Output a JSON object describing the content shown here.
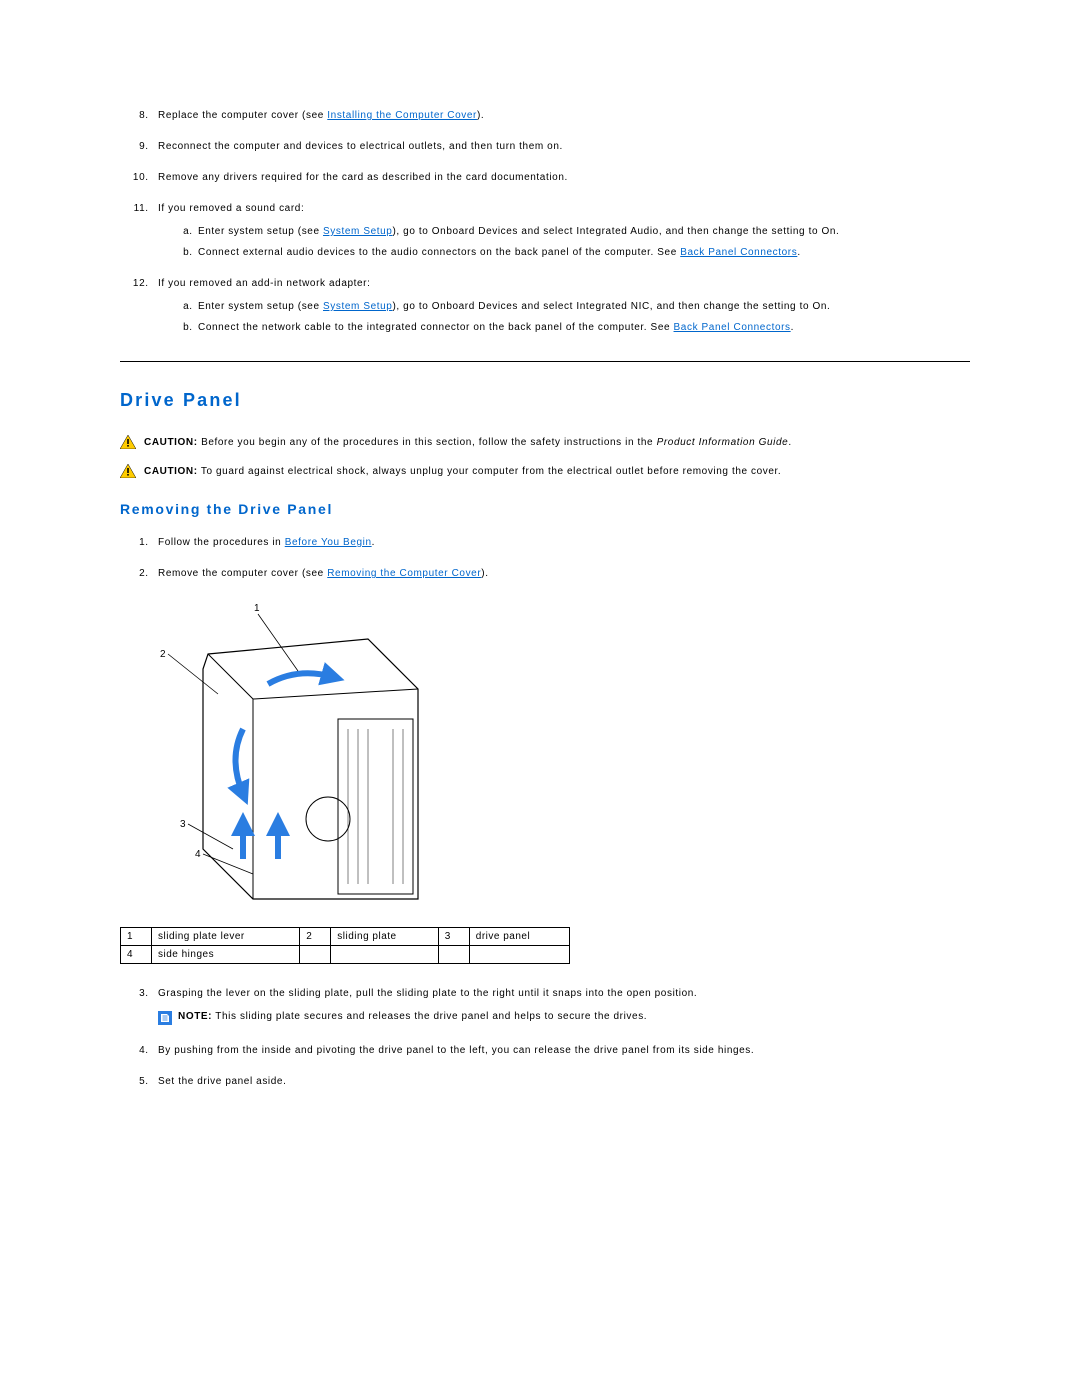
{
  "top_steps": {
    "start": 8,
    "items": [
      {
        "prefix": "Replace the computer cover (see ",
        "link": "Installing the Computer Cover",
        "suffix": ")."
      },
      {
        "text": "Reconnect the computer and devices to electrical outlets, and then turn them on."
      },
      {
        "text": "Remove any drivers required for the card as described in the card documentation."
      },
      {
        "text": "If you removed a sound card:",
        "sub": [
          {
            "prefix": "Enter system setup (see ",
            "link": "System Setup",
            "suffix": "), go to Onboard Devices and select Integrated Audio, and then change the setting to On."
          },
          {
            "prefix": "Connect external audio devices to the audio connectors on the back panel of the computer. See ",
            "link": "Back Panel Connectors",
            "suffix": "."
          }
        ]
      },
      {
        "text": "If you removed an add-in network adapter:",
        "sub": [
          {
            "prefix": "Enter system setup (see ",
            "link": "System Setup",
            "suffix": "), go to Onboard Devices and select Integrated NIC, and then change the setting to On."
          },
          {
            "prefix": "Connect the network cable to the integrated connector on the back panel of the computer. See ",
            "link": "Back Panel Connectors",
            "suffix": "."
          }
        ]
      }
    ]
  },
  "section_heading": "Drive Panel",
  "caution1": {
    "label": "CAUTION:",
    "body_pre": " Before you begin any of the procedures in this section, follow the safety instructions in the ",
    "body_em": "Product Information Guide",
    "body_post": "."
  },
  "caution2": {
    "label": "CAUTION:",
    "body": " To guard against electrical shock, always unplug your computer from the electrical outlet before removing the cover."
  },
  "subsection_heading": "Removing the Drive Panel",
  "removing_steps_a": [
    {
      "prefix": "Follow the procedures in ",
      "link": "Before You Begin",
      "suffix": "."
    },
    {
      "prefix": "Remove the computer cover (see ",
      "link": "Removing the Computer Cover",
      "suffix": ")."
    }
  ],
  "legend": {
    "rows": [
      [
        {
          "n": "1",
          "t": "sliding plate lever"
        },
        {
          "n": "2",
          "t": "sliding plate"
        },
        {
          "n": "3",
          "t": "drive panel"
        }
      ],
      [
        {
          "n": "4",
          "t": "side hinges"
        },
        {
          "n": "",
          "t": ""
        },
        {
          "n": "",
          "t": ""
        }
      ]
    ]
  },
  "removing_steps_b": {
    "start": 3,
    "items": [
      {
        "text": "Grasping the lever on the sliding plate, pull the sliding plate to the right until it snaps into the open position.",
        "note": {
          "label": "NOTE:",
          "body": " This sliding plate secures and releases the drive panel and helps to secure the drives."
        }
      },
      {
        "text": "By pushing from the inside and pivoting the drive panel to the left, you can release the drive panel from its side hinges."
      },
      {
        "text": "Set the drive panel aside."
      }
    ]
  }
}
